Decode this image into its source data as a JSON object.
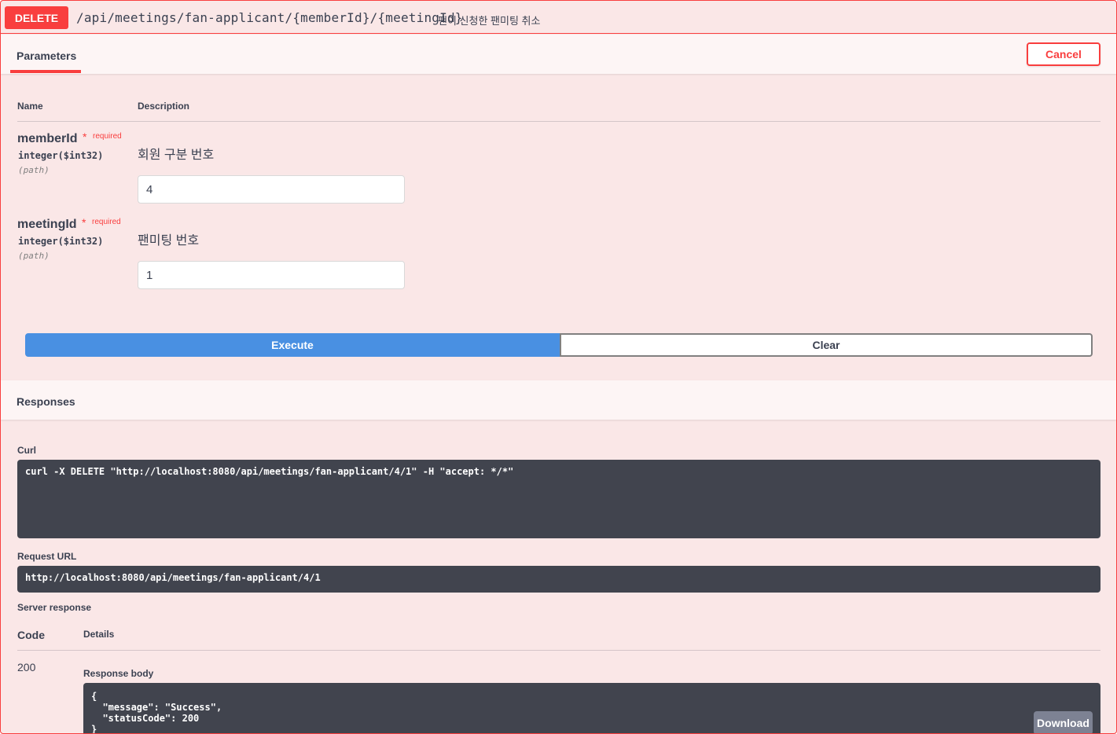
{
  "operation": {
    "method": "DELETE",
    "path": "/api/meetings/fan-applicant/{memberId}/{meetingId}",
    "summary": "팬이 신청한 팬미팅 취소"
  },
  "parameters_section": {
    "title": "Parameters",
    "cancel_label": "Cancel",
    "col_name": "Name",
    "col_description": "Description",
    "required_label": "required",
    "required_star": "*",
    "items": [
      {
        "name": "memberId",
        "type": "integer($int32)",
        "in": "(path)",
        "description": "회원 구분 번호",
        "value": "4"
      },
      {
        "name": "meetingId",
        "type": "integer($int32)",
        "in": "(path)",
        "description": "팬미팅 번호",
        "value": "1"
      }
    ]
  },
  "actions": {
    "execute_label": "Execute",
    "clear_label": "Clear"
  },
  "responses_section": {
    "title": "Responses",
    "curl_label": "Curl",
    "curl_command": "curl -X DELETE \"http://localhost:8080/api/meetings/fan-applicant/4/1\" -H \"accept: */*\"",
    "request_url_label": "Request URL",
    "request_url": "http://localhost:8080/api/meetings/fan-applicant/4/1",
    "server_response_label": "Server response",
    "col_code": "Code",
    "col_details": "Details",
    "code": "200",
    "response_body_label": "Response body",
    "response_body": "{\n  \"message\": \"Success\",\n  \"statusCode\": 200\n}",
    "download_label": "Download"
  },
  "colors": {
    "delete_accent": "#f93e3e",
    "block_bg": "#fae7e7",
    "execute_blue": "#4990e2",
    "code_bg": "#41444e"
  }
}
